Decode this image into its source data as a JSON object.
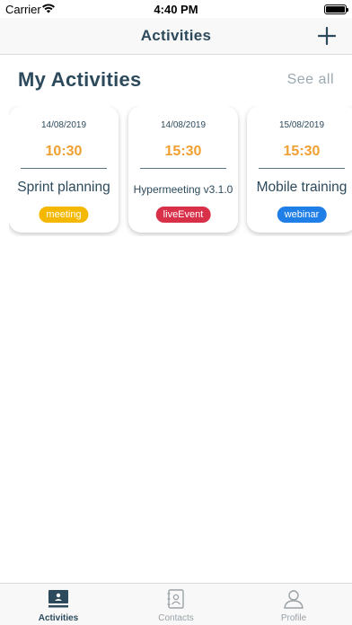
{
  "status": {
    "carrier": "Carrier",
    "time": "4:40 PM"
  },
  "nav": {
    "title": "Activities"
  },
  "section": {
    "title": "My Activities",
    "see_all": "See all"
  },
  "activities": [
    {
      "date": "14/08/2019",
      "time": "10:30",
      "name": "Sprint planning",
      "type": "meeting",
      "color": "#f5b800"
    },
    {
      "date": "14/08/2019",
      "time": "15:30",
      "name": "Hypermeeting v3.1.0",
      "type": "liveEvent",
      "color": "#d9304a"
    },
    {
      "date": "15/08/2019",
      "time": "15:30",
      "name": "Mobile training",
      "type": "webinar",
      "color": "#1f7fe6"
    }
  ],
  "tabs": [
    {
      "label": "Activities",
      "icon": "presentation-icon",
      "active": true
    },
    {
      "label": "Contacts",
      "icon": "contact-card-icon",
      "active": false
    },
    {
      "label": "Profile",
      "icon": "person-icon",
      "active": false
    }
  ],
  "colors": {
    "accent": "#f0a030",
    "text": "#2c4a5c",
    "muted": "#9aa9b2"
  }
}
